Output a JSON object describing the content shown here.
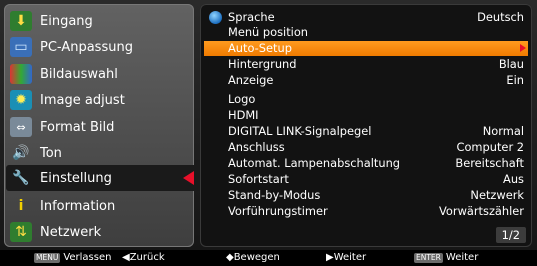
{
  "left_menu": [
    {
      "label": "Eingang",
      "icon": "input-icon"
    },
    {
      "label": "PC-Anpassung",
      "icon": "pc-adjust-icon"
    },
    {
      "label": "Bildauswahl",
      "icon": "image-select-icon"
    },
    {
      "label": "Image adjust",
      "icon": "image-adjust-icon"
    },
    {
      "label": "Format Bild",
      "icon": "screen-format-icon"
    },
    {
      "label": "Ton",
      "icon": "sound-icon"
    },
    {
      "label": "Einstellung",
      "icon": "settings-icon",
      "selected": true
    },
    {
      "label": "Information",
      "icon": "information-icon"
    },
    {
      "label": "Netzwerk",
      "icon": "network-icon"
    }
  ],
  "settings": [
    {
      "label": "Sprache",
      "value": "Deutsch"
    },
    {
      "label": "Menü position",
      "value": ""
    },
    {
      "label": "Auto-Setup",
      "value": "",
      "highlighted": true
    },
    {
      "label": "Hintergrund",
      "value": "Blau"
    },
    {
      "label": "Anzeige",
      "value": "Ein"
    },
    {
      "label": "Logo",
      "value": ""
    },
    {
      "label": "HDMI",
      "value": ""
    },
    {
      "label": "DIGITAL LINK-Signalpegel",
      "value": "Normal"
    },
    {
      "label": "Anschluss",
      "value": "Computer 2"
    },
    {
      "label": "Automat. Lampenabschaltung",
      "value": "Bereitschaft"
    },
    {
      "label": "Sofortstart",
      "value": "Aus"
    },
    {
      "label": "Stand-by-Modus",
      "value": "Netzwerk"
    },
    {
      "label": "Vorführungstimer",
      "value": "Vorwärtszähler"
    }
  ],
  "page_indicator": "1/2",
  "bottom_bar": {
    "menu_key": "MENU",
    "exit_label": "Verlassen",
    "back_label": "◀Zurück",
    "move_label": "◆Bewegen",
    "next_label": "▶Weiter",
    "enter_key": "ENTER",
    "enter_label": "Weiter"
  },
  "colors": {
    "highlight": "#f58400",
    "selection_arrow": "#e8102a",
    "panel_bg": "#121212"
  }
}
